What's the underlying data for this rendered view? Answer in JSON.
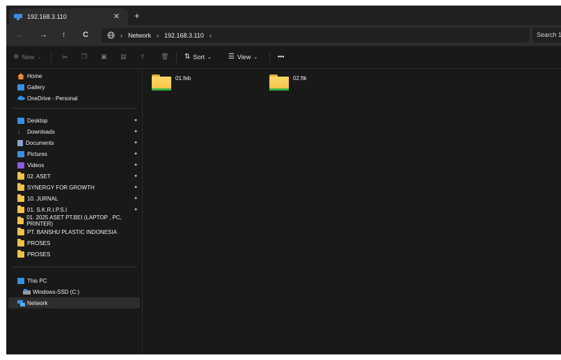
{
  "tab": {
    "title": "192.168.3.110",
    "close_glyph": "✕",
    "new_glyph": "+"
  },
  "nav": {
    "back_glyph": "←",
    "forward_glyph": "→",
    "up_glyph": "↑",
    "refresh_glyph": "C",
    "address": {
      "network_icon": "globe-icon",
      "segments": [
        "Network",
        "192.168.3.110"
      ],
      "separator": "›"
    },
    "search_placeholder": "Search 1"
  },
  "toolbar": {
    "new_label": "New",
    "sort_label": "Sort",
    "view_label": "View",
    "more_label": "•••"
  },
  "sidebar": {
    "top": [
      {
        "label": "Home",
        "icon": "home-icon"
      },
      {
        "label": "Gallery",
        "icon": "gallery-icon"
      },
      {
        "label": "OneDrive - Personal",
        "icon": "cloud-icon"
      }
    ],
    "quick": [
      {
        "label": "Desktop",
        "icon": "desktop-icon",
        "pinned": true
      },
      {
        "label": "Downloads",
        "icon": "download-icon",
        "pinned": true
      },
      {
        "label": "Documents",
        "icon": "document-icon",
        "pinned": true
      },
      {
        "label": "Pictures",
        "icon": "pictures-icon",
        "pinned": true
      },
      {
        "label": "Videos",
        "icon": "videos-icon",
        "pinned": true
      },
      {
        "label": "02. ASET",
        "icon": "folder-icon",
        "pinned": true
      },
      {
        "label": "SYNERGY FOR GROWTH",
        "icon": "folder-icon",
        "pinned": true
      },
      {
        "label": "10. JURNAL",
        "icon": "folder-icon",
        "pinned": true
      },
      {
        "label": "01. S.K.R.I.P.S.I",
        "icon": "folder-icon",
        "pinned": true
      },
      {
        "label": "01. 2025 ASET PT.BEI (LAPTOP , PC, PRINTER)",
        "icon": "folder-icon",
        "pinned": false
      },
      {
        "label": "PT. BANSHU PLASTIC INDONESIA",
        "icon": "folder-icon",
        "pinned": false
      },
      {
        "label": "PROSES",
        "icon": "folder-icon",
        "pinned": false
      },
      {
        "label": "PROSES",
        "icon": "folder-icon",
        "pinned": false
      }
    ],
    "pc": [
      {
        "label": "This PC",
        "icon": "pc-icon"
      },
      {
        "label": "Windows-SSD (C:)",
        "icon": "drive-icon"
      },
      {
        "label": "Network",
        "icon": "network-icon"
      }
    ],
    "pin_glyph": "📌"
  },
  "content": {
    "items": [
      {
        "name": "01.feb",
        "icon": "folder-icon"
      },
      {
        "name": "02.ftk",
        "icon": "folder-icon"
      }
    ]
  },
  "colors": {
    "background": "#191919",
    "folder": "#f0c24a",
    "accent": "#3b8ee0"
  }
}
